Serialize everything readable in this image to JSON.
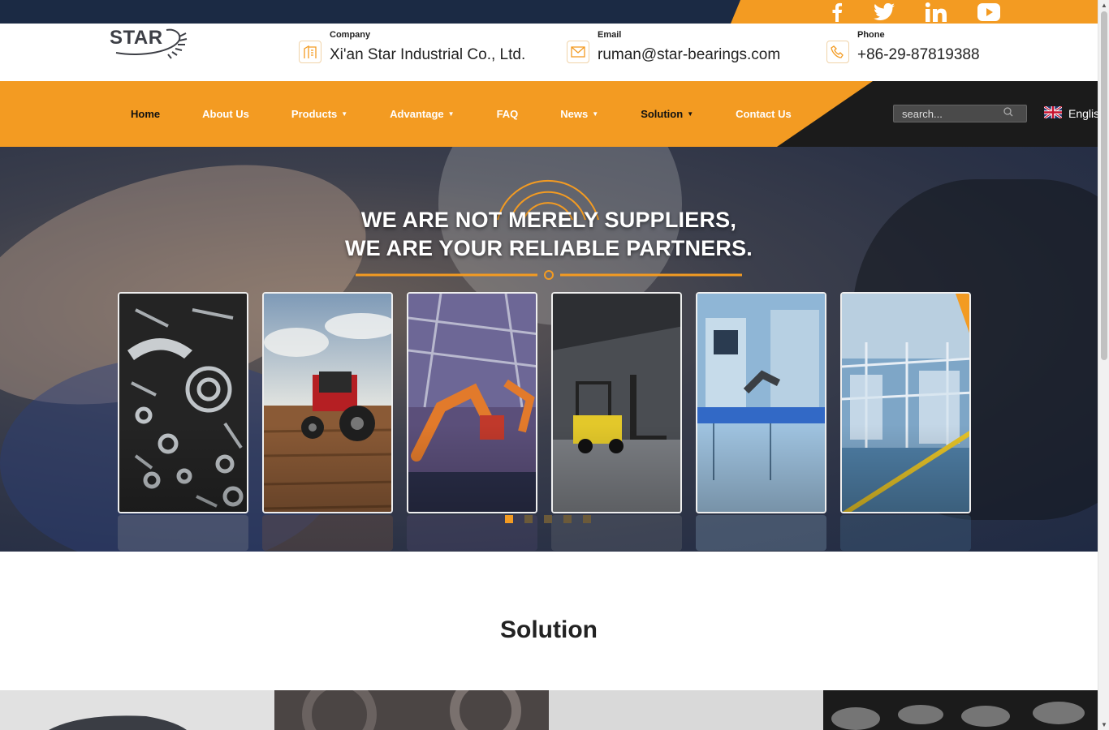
{
  "social": {
    "icons": [
      "facebook-icon",
      "twitter-icon",
      "linkedin-icon",
      "youtube-icon"
    ],
    "bar_color": "#1b2a44",
    "accent_color": "#f39b22"
  },
  "header": {
    "logo_text": "STAR",
    "company": {
      "label": "Company",
      "value": "Xi'an Star Industrial Co., Ltd."
    },
    "email": {
      "label": "Email",
      "value": "ruman@star-bearings.com"
    },
    "phone": {
      "label": "Phone",
      "value": "+86-29-87819388"
    }
  },
  "nav": {
    "items": [
      {
        "label": "Home",
        "has_dropdown": false
      },
      {
        "label": "About Us",
        "has_dropdown": false
      },
      {
        "label": "Products",
        "has_dropdown": true
      },
      {
        "label": "Advantage",
        "has_dropdown": true
      },
      {
        "label": "FAQ",
        "has_dropdown": false
      },
      {
        "label": "News",
        "has_dropdown": true
      },
      {
        "label": "Solution",
        "has_dropdown": true
      },
      {
        "label": "Contact Us",
        "has_dropdown": false
      }
    ],
    "search_placeholder": "search...",
    "language": "Englis"
  },
  "hero": {
    "line1": "WE ARE NOT MERELY SUPPLIERS,",
    "line2": "WE ARE YOUR RELIABLE PARTNERS.",
    "cards": [
      {
        "name": "auto-parts"
      },
      {
        "name": "tractor"
      },
      {
        "name": "robot-arm"
      },
      {
        "name": "forklift"
      },
      {
        "name": "automation-lab"
      },
      {
        "name": "factory-line"
      }
    ],
    "slides": 5,
    "active_slide": 1
  },
  "solution": {
    "title": "Solution"
  }
}
